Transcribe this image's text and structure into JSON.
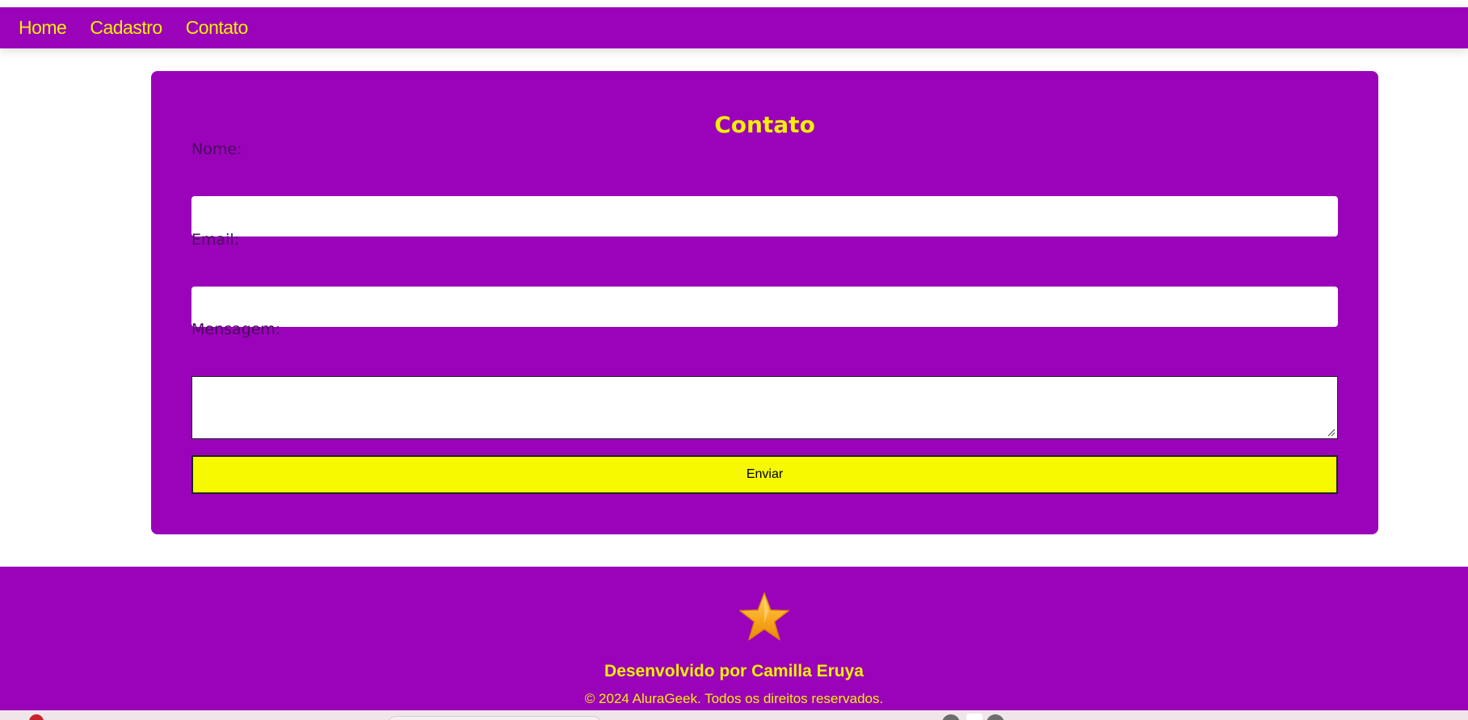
{
  "nav": {
    "items": [
      {
        "label": "Home"
      },
      {
        "label": "Cadastro"
      },
      {
        "label": "Contato"
      }
    ]
  },
  "form": {
    "title": "Contato",
    "name_label": "Nome:",
    "name_value": "",
    "email_label": "Email:",
    "email_value": "",
    "message_label": "Mensagem:",
    "message_value": "",
    "submit_label": "Enviar"
  },
  "footer": {
    "icon": "star-icon",
    "developer": "Desenvolvido por Camilla Eruya",
    "copyright": "© 2024 AluraGeek. Todos os direitos reservados."
  },
  "colors": {
    "primary": "#9a03b9",
    "accent": "#f5ee05",
    "button": "#f7f900",
    "label": "#4a0a5e"
  }
}
